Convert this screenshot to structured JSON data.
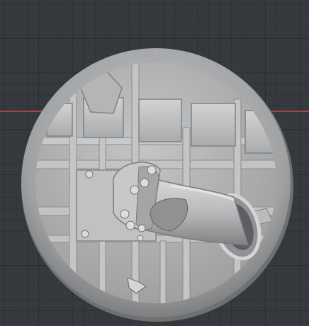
{
  "viewport": {
    "background_color": "#36393d",
    "grid_major_color": "#2a2d30",
    "grid_minor_color": "#303336",
    "axis_x_color": "#c8323c"
  },
  "model": {
    "kind": "round miniature base with cylindrical pipe and grate detail",
    "base_color": "#a9abad",
    "rim_color": "#8e9092",
    "highlight_color": "#d8d9da",
    "shadow_color": "#5d5f62"
  }
}
